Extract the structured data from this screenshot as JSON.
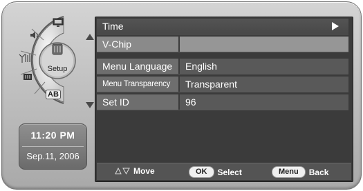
{
  "dial": {
    "setup_label": "Setup",
    "icons": [
      "monitor-icon",
      "speaker-icon",
      "antenna-icon",
      "lock-icon",
      "input-icon"
    ],
    "input_label": "AB"
  },
  "clock": {
    "time": "11:20 PM",
    "date": "Sep.11, 2006"
  },
  "menu": {
    "items": [
      {
        "label": "Time",
        "value": ""
      },
      {
        "label": "V-Chip",
        "value": ""
      },
      {
        "label": "Menu Language",
        "value": "English"
      },
      {
        "label": "Menu Transparency",
        "value": "Transparent"
      },
      {
        "label": "Set ID",
        "value": "96"
      }
    ]
  },
  "footer": {
    "move_label": "Move",
    "ok_key": "OK",
    "select_label": "Select",
    "menu_key": "Menu",
    "back_label": "Back"
  },
  "colors": {
    "panel": "#3b3b3b",
    "row_selected": "#4e4e4e",
    "row_disabled": "#8a8a8a",
    "clock_bg": "#7a7a7a"
  }
}
